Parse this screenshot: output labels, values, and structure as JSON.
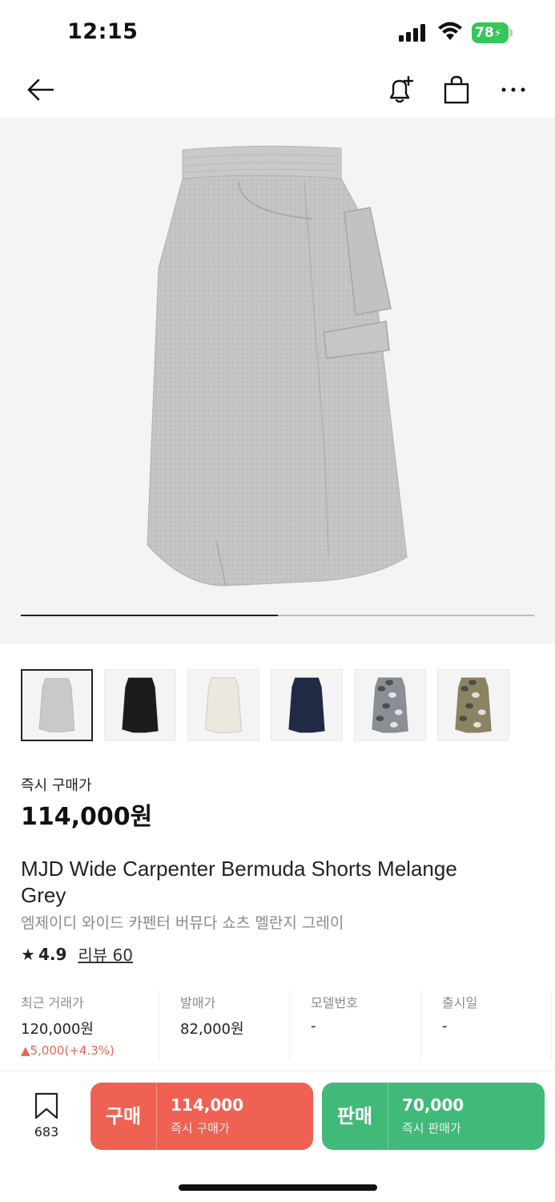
{
  "status_bar": {
    "time": "12:15",
    "battery": "78",
    "battery_color": "#34c759"
  },
  "header": {
    "icons": [
      "back-arrow-icon",
      "bell-plus-icon",
      "shopping-bag-icon",
      "more-icon"
    ]
  },
  "hero": {
    "image": "melange-grey-bermuda-shorts",
    "slide_progress": 0.5
  },
  "thumbnails": [
    {
      "name": "grey",
      "color": "#c9c9c9",
      "selected": true
    },
    {
      "name": "black",
      "color": "#1c1c1c",
      "selected": false
    },
    {
      "name": "ivory",
      "color": "#ece8dd",
      "selected": false
    },
    {
      "name": "navy",
      "color": "#1f2a44",
      "selected": false
    },
    {
      "name": "grey-camo",
      "color": "#8a8f96",
      "selected": false
    },
    {
      "name": "khaki-camo",
      "color": "#8b8463",
      "selected": false
    }
  ],
  "product": {
    "price_label": "즉시 구매가",
    "price": "114,000원",
    "title_en": "MJD Wide Carpenter Bermuda Shorts Melange Grey",
    "title_ko": "엠제이디 와이드 카펜터 버뮤다 쇼츠 멜란지 그레이",
    "rating": "4.9",
    "review_link": "리뷰 60"
  },
  "info": [
    {
      "label": "최근 거래가",
      "value": "120,000원",
      "change": "▲5,000(+4.3%)"
    },
    {
      "label": "발매가",
      "value": "82,000원",
      "change": ""
    },
    {
      "label": "모델번호",
      "value": "-",
      "change": ""
    },
    {
      "label": "출시일",
      "value": "-",
      "change": ""
    }
  ],
  "bottom": {
    "bookmark_count": "683",
    "buy": {
      "kind": "구매",
      "price": "114,000",
      "sub": "즉시 구매가",
      "color": "#ef6253"
    },
    "sell": {
      "kind": "판매",
      "price": "70,000",
      "sub": "즉시 판매가",
      "color": "#41b979"
    }
  }
}
